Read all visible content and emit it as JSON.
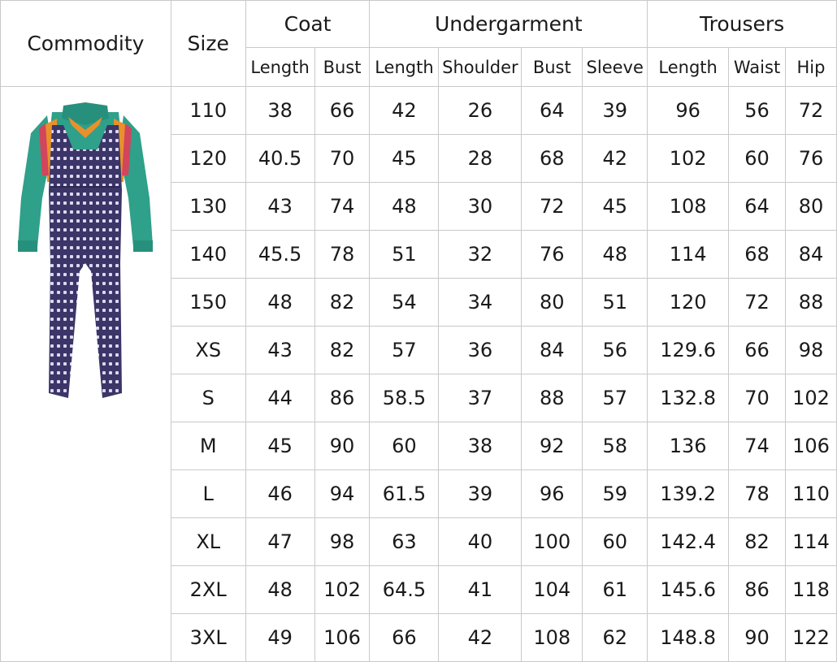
{
  "headers": {
    "commodity": "Commodity",
    "size": "Size",
    "groups": {
      "coat": "Coat",
      "undergarment": "Undergarment",
      "trousers": "Trousers"
    },
    "subs": [
      "Length",
      "Bust",
      "Length",
      "Shoulder",
      "Bust",
      "Sleeve",
      "Length",
      "Waist",
      "Hip"
    ]
  },
  "product_image": {
    "icon": "overalls-costume-illustration",
    "colors": {
      "shirt": "#2fa08a",
      "overall": "#3b3568",
      "dots": "#dcd8f0",
      "collar_trim": "#e8912a"
    }
  },
  "rows": [
    [
      "110",
      "38",
      "66",
      "42",
      "26",
      "64",
      "39",
      "96",
      "56",
      "72"
    ],
    [
      "120",
      "40.5",
      "70",
      "45",
      "28",
      "68",
      "42",
      "102",
      "60",
      "76"
    ],
    [
      "130",
      "43",
      "74",
      "48",
      "30",
      "72",
      "45",
      "108",
      "64",
      "80"
    ],
    [
      "140",
      "45.5",
      "78",
      "51",
      "32",
      "76",
      "48",
      "114",
      "68",
      "84"
    ],
    [
      "150",
      "48",
      "82",
      "54",
      "34",
      "80",
      "51",
      "120",
      "72",
      "88"
    ],
    [
      "XS",
      "43",
      "82",
      "57",
      "36",
      "84",
      "56",
      "129.6",
      "66",
      "98"
    ],
    [
      "S",
      "44",
      "86",
      "58.5",
      "37",
      "88",
      "57",
      "132.8",
      "70",
      "102"
    ],
    [
      "M",
      "45",
      "90",
      "60",
      "38",
      "92",
      "58",
      "136",
      "74",
      "106"
    ],
    [
      "L",
      "46",
      "94",
      "61.5",
      "39",
      "96",
      "59",
      "139.2",
      "78",
      "110"
    ],
    [
      "XL",
      "47",
      "98",
      "63",
      "40",
      "100",
      "60",
      "142.4",
      "82",
      "114"
    ],
    [
      "2XL",
      "48",
      "102",
      "64.5",
      "41",
      "104",
      "61",
      "145.6",
      "86",
      "118"
    ],
    [
      "3XL",
      "49",
      "106",
      "66",
      "42",
      "108",
      "62",
      "148.8",
      "90",
      "122"
    ]
  ]
}
